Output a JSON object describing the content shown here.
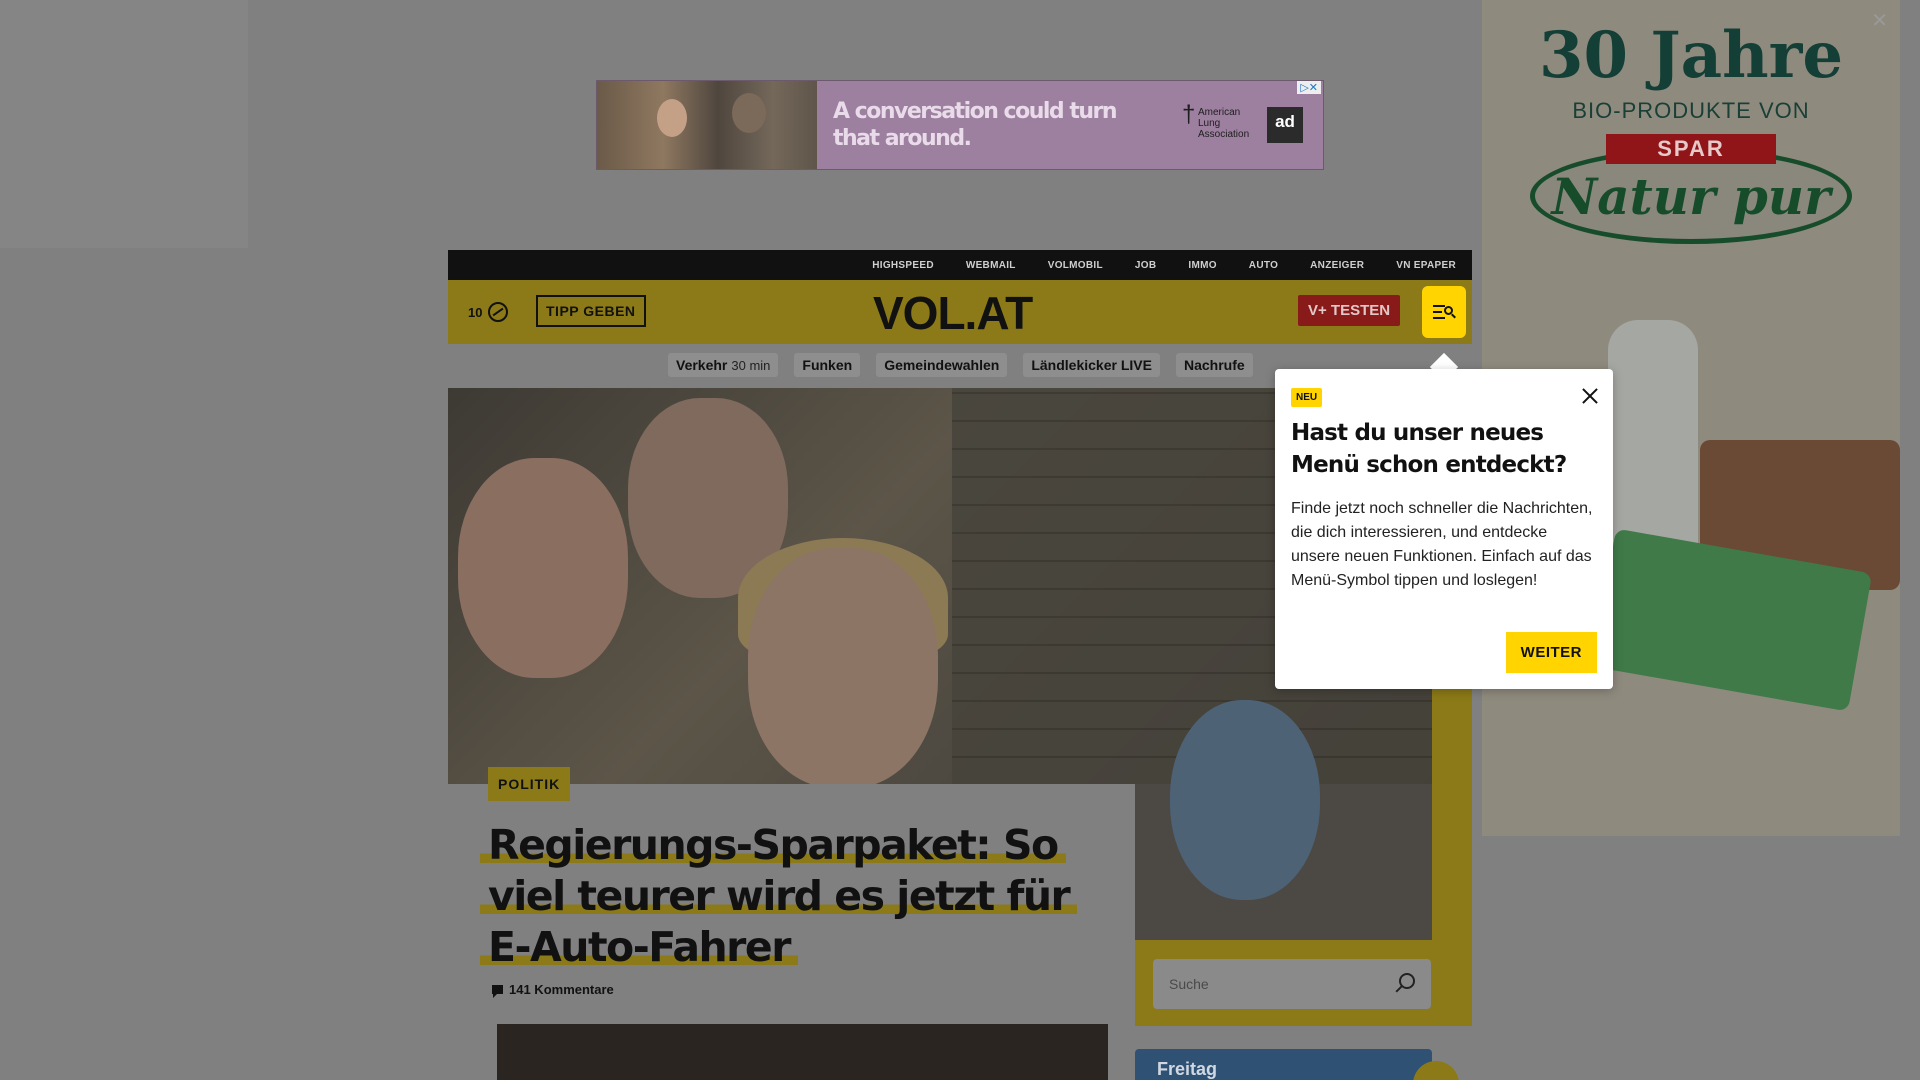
{
  "banner_ad": {
    "headline": "A conversation could turn that around.",
    "sponsor": "American Lung Association",
    "logo": "ad",
    "adchoices": "▷✕"
  },
  "topnav": [
    "HIGHSPEED",
    "WEBMAIL",
    "VOLMOBIL",
    "JOB",
    "IMMO",
    "AUTO",
    "ANZEIGER",
    "VN EPAPER"
  ],
  "header": {
    "temperature": "10",
    "tipp_label": "TIPP GEBEN",
    "logo": "VOL.AT",
    "vplus_label": "V+ TESTEN"
  },
  "chips": [
    {
      "label": "Verkehr",
      "extra": "30 min"
    },
    {
      "label": "Funken",
      "extra": ""
    },
    {
      "label": "Gemeindewahlen",
      "extra": ""
    },
    {
      "label": "Ländlekicker LIVE",
      "extra": ""
    },
    {
      "label": "Nachrufe",
      "extra": ""
    }
  ],
  "article": {
    "category": "POLITIK",
    "title": "Regierungs-Sparpaket: So viel teurer wird es jetzt für E-Auto-Fahrer",
    "comments": "141 Kommentare"
  },
  "sidebar": {
    "search_placeholder": "Suche",
    "weather_day": "Freitag"
  },
  "sky_ad": {
    "title": "30 Jahre",
    "subtitle": "BIO-PRODUKTE VON",
    "brand": "SPAR",
    "product_line": "Natur pur",
    "close": "✕"
  },
  "popup": {
    "badge": "NEU",
    "title": "Hast du unser neues Menü schon entdeckt?",
    "body": "Finde jetzt noch schneller die Nachrichten, die dich interessieren, und entdecke unsere neuen Funktionen. Einfach auf das Menü-Symbol tippen und loslegen!",
    "button": "WEITER"
  },
  "colors": {
    "brand_yellow": "#ffd400",
    "dimmed_yellow": "#8b7a17",
    "vplus_red": "#891a1a"
  }
}
